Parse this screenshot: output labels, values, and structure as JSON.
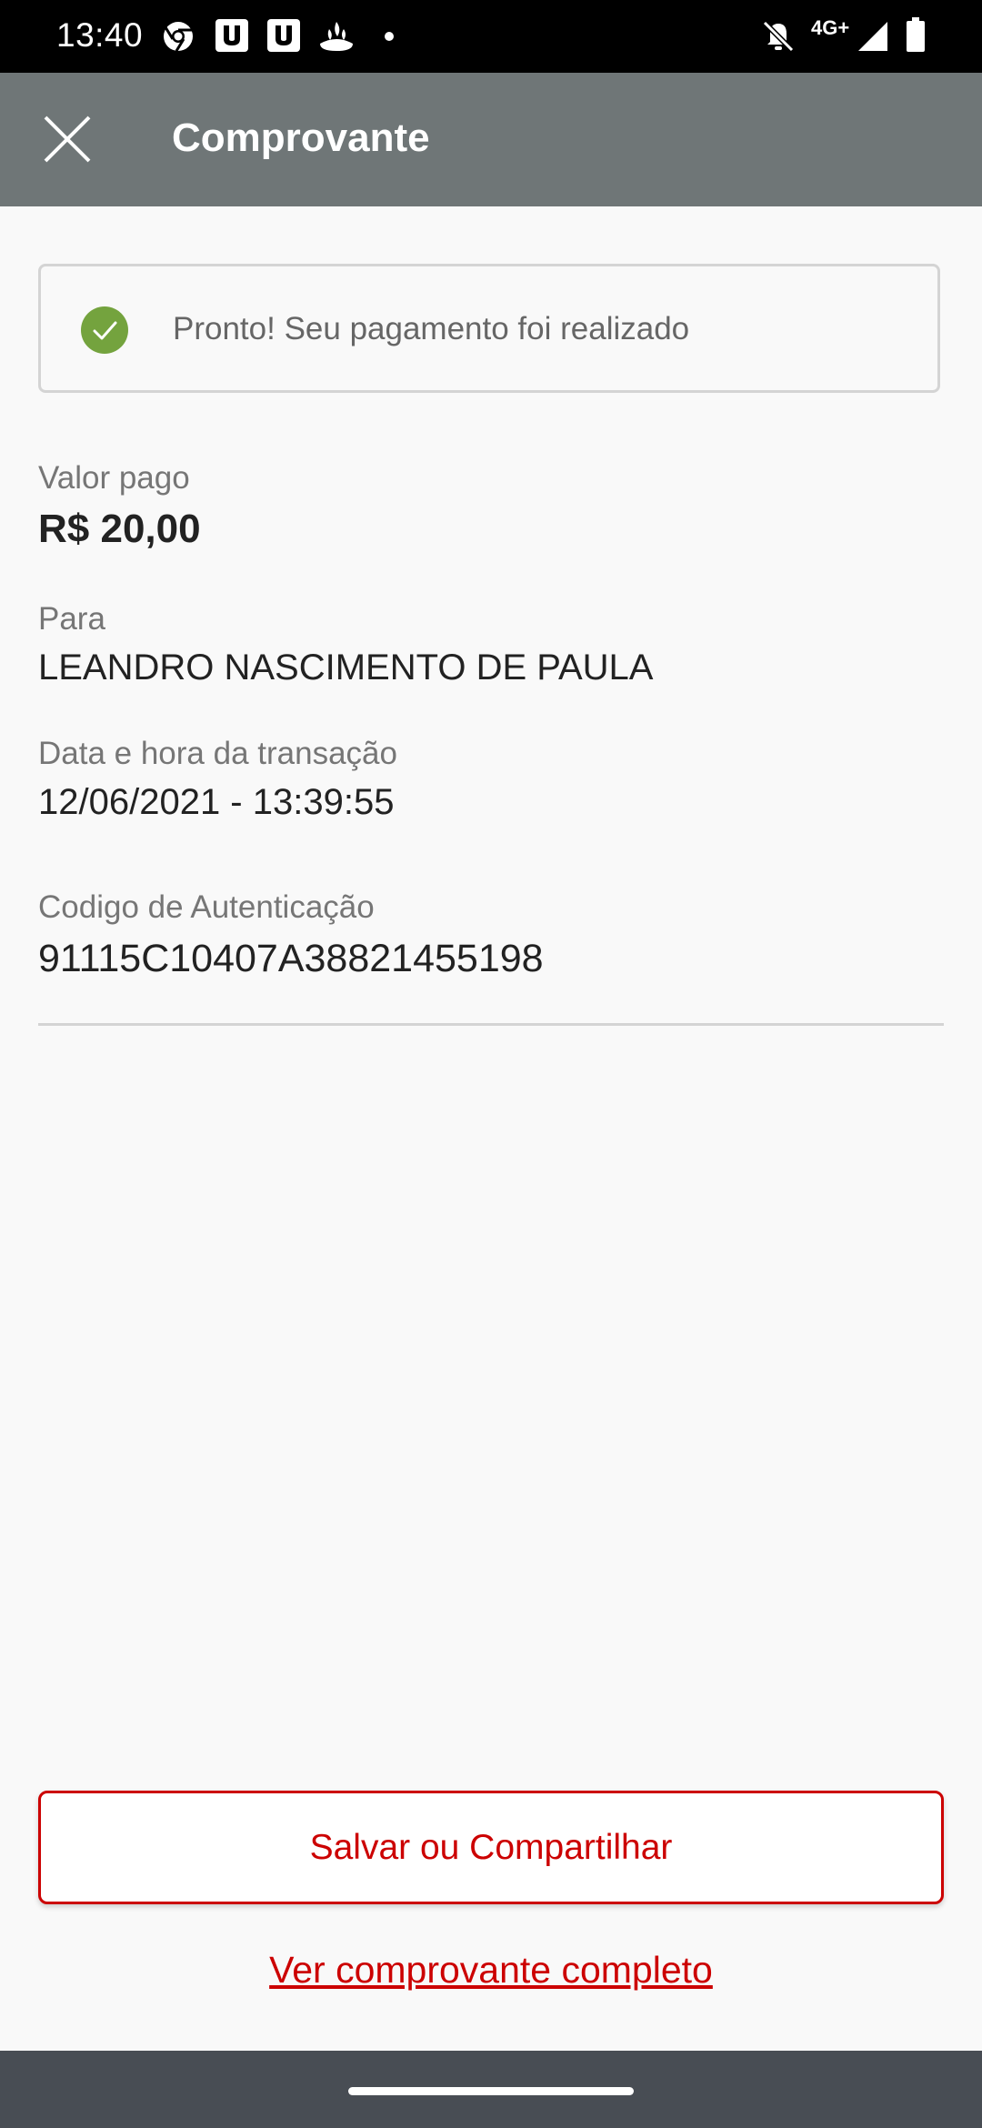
{
  "status_bar": {
    "time": "13:40",
    "network": "4G+",
    "left_icons": [
      "chrome-icon",
      "app-u-icon",
      "app-u-icon",
      "santander-icon",
      "dot-icon"
    ],
    "right_icons": [
      "notifications-off-icon",
      "signal-icon",
      "battery-icon"
    ]
  },
  "app_bar": {
    "title": "Comprovante",
    "close_icon": "close-icon",
    "background": "#6f7677"
  },
  "success": {
    "message": "Pronto! Seu pagamento foi realizado",
    "icon": "check-circle-icon",
    "icon_color": "#74a33e"
  },
  "fields": {
    "amount": {
      "label": "Valor pago",
      "value": "R$ 20,00"
    },
    "recipient": {
      "label": "Para",
      "value": "LEANDRO NASCIMENTO DE PAULA"
    },
    "datetime": {
      "label": "Data e hora da transação",
      "value": "12/06/2021 - 13:39:55"
    },
    "auth_code": {
      "label": "Codigo de Autenticação",
      "value": "91115C10407A38821455198"
    }
  },
  "actions": {
    "save_share_label": "Salvar ou Compartilhar",
    "full_receipt_label": "Ver comprovante completo",
    "accent_color": "#cc0000"
  }
}
